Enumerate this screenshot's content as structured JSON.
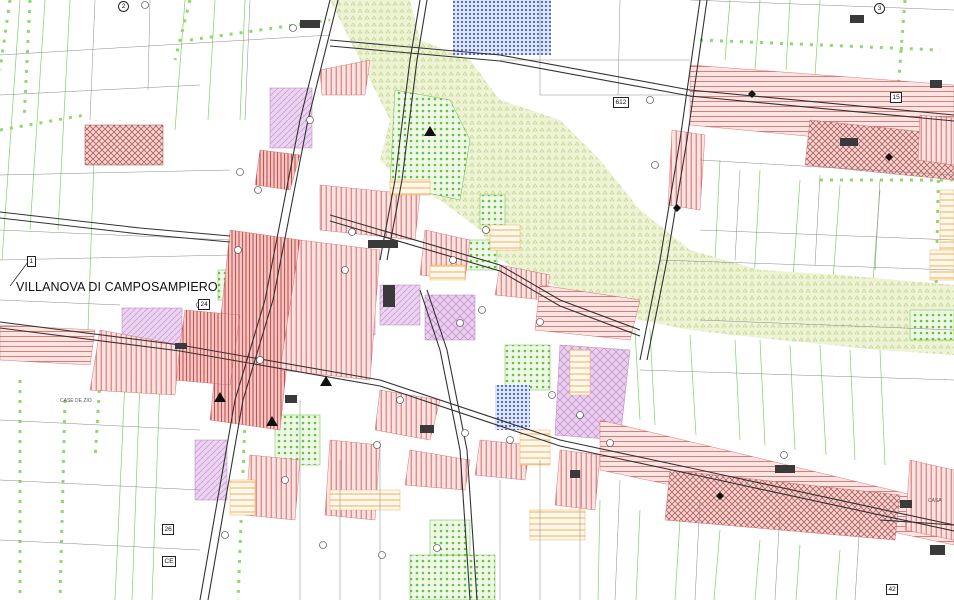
{
  "map": {
    "place_name": "VILLANOVA DI CAMPOSAMPIERO",
    "small_label_west": "CASE DE ZIO",
    "small_label_east": "CASA",
    "reference_tags": [
      {
        "id": "ref-1",
        "text": "1",
        "shape": "box"
      },
      {
        "id": "ref-2",
        "text": "2",
        "shape": "circle"
      },
      {
        "id": "ref-3",
        "text": "3",
        "shape": "circle"
      },
      {
        "id": "ref-15",
        "text": "15",
        "shape": "box"
      },
      {
        "id": "ref-24",
        "text": "24",
        "shape": "box"
      },
      {
        "id": "ref-26",
        "text": "26",
        "shape": "box"
      },
      {
        "id": "ref-42",
        "text": "42",
        "shape": "box"
      },
      {
        "id": "ref-612",
        "text": "612",
        "shape": "box"
      },
      {
        "id": "ref-cbl",
        "text": "CE",
        "shape": "box"
      }
    ]
  },
  "colors": {
    "residential_red": "#d86a6a",
    "residential_dark": "#b84a4a",
    "service_purple": "#d9aee0",
    "park_green": "#7fc45a",
    "agri_green_line": "#6fcf55",
    "hatch_orange": "#f3b15a",
    "blue_area": "#2c4bb0",
    "corridor_olive": "#e6efc9",
    "road_black": "#222222"
  }
}
